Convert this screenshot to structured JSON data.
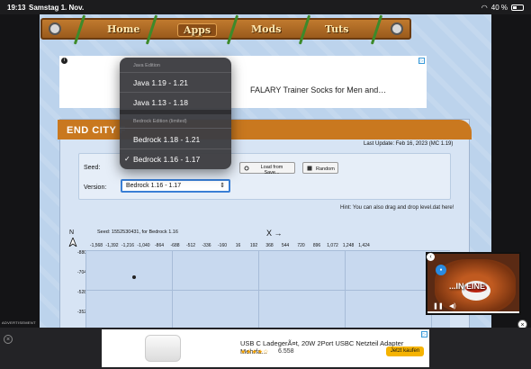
{
  "status": {
    "time": "19:13",
    "date": "Samstag 1. Nov.",
    "battery": "40 %"
  },
  "nav": {
    "items": [
      "Home",
      "Apps",
      "Mods",
      "Tuts"
    ]
  },
  "ad_top": {
    "text": "FALARY Trainer Socks for Men and…"
  },
  "panel": {
    "title": "END CITY F",
    "last_update": "Last Update: Feb 16, 2023 (MC 1.19)",
    "seed_label": "Seed:",
    "version_label": "Version:",
    "version_value": "Bedrock 1.16 - 1.17",
    "load_button": "Load from Save...",
    "random_button": "Random",
    "hint": "Hint: You can also drag and drop level.dat here!"
  },
  "map": {
    "seed_line": "Seed: 1552530431, for Bedrock 1.16",
    "x_arrow": "X →",
    "compass": "N",
    "x_ticks": [
      "-1,568",
      "-1,392",
      "-1,216",
      "-1,040",
      "-864",
      "-688",
      "-512",
      "-336",
      "-160",
      "16",
      "192",
      "368",
      "544",
      "720",
      "896",
      "1,072",
      "1,248",
      "1,424"
    ],
    "y_ticks": [
      "-880",
      "-704",
      "-528",
      "-352"
    ]
  },
  "menu": {
    "java_header": "Java Edition",
    "java_options": [
      "Java 1.19 - 1.21",
      "Java 1.13 - 1.18"
    ],
    "bedrock_header": "Bedrock Edition (limited)",
    "bedrock_options": [
      "Bedrock 1.18 - 1.21",
      "Bedrock 1.16 - 1.17"
    ],
    "check": "✓"
  },
  "video_ad": {
    "caption": "...IN EINE"
  },
  "ad_bottom": {
    "label": "ADVERTISEMENT",
    "title": "USB C LadegerÃ¤t, 20W 2Port USBC Netzteil Adapter Mehrfa...",
    "stars": "★★★★☆",
    "reviews": "6.558",
    "cta": "Jetzt kaufen"
  }
}
